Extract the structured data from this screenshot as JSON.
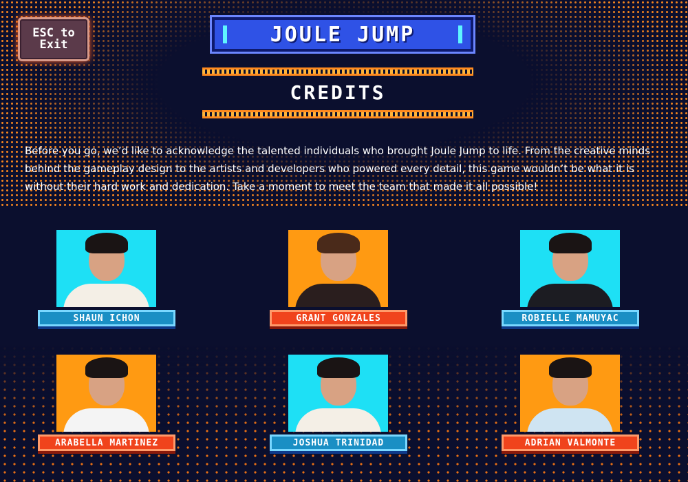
{
  "header": {
    "esc_label": "ESC to Exit",
    "game_title": "JOULE JUMP",
    "section_title": "CREDITS"
  },
  "intro_text": "Before you go, we’d like to acknowledge the talented individuals who brought Joule Jump to life. From the creative minds behind the gameplay design to the artists and developers who powered every detail, this game wouldn’t be what it is without their hard work and dedication. Take a moment to meet the team that made it all possible!",
  "colors": {
    "background": "#0b0f2e",
    "cyan_photo_bg": "#1ee0f5",
    "orange_photo_bg": "#ff9a12",
    "blue_bar": "#1a8fc4",
    "red_bar": "#f0431c",
    "title_blue": "#2f52e6"
  },
  "team": [
    {
      "name": "SHAUN ICHON",
      "photo_bg": "#1ee0f5",
      "bar": "blue",
      "hair": "#1a1414",
      "shirt": "#f4efe6"
    },
    {
      "name": "GRANT GONZALES",
      "photo_bg": "#ff9a12",
      "bar": "red",
      "hair": "#4a2a1a",
      "shirt": "#2a1e1e"
    },
    {
      "name": "ROBIELLE MAMUYAC",
      "photo_bg": "#1ee0f5",
      "bar": "blue",
      "hair": "#1a1414",
      "shirt": "#1c1c22"
    },
    {
      "name": "ARABELLA MARTINEZ",
      "photo_bg": "#ff9a12",
      "bar": "red",
      "hair": "#1a1414",
      "shirt": "#f4f4f4"
    },
    {
      "name": "JOSHUA TRINIDAD",
      "photo_bg": "#1ee0f5",
      "bar": "blue",
      "hair": "#1a1414",
      "shirt": "#f4efe6"
    },
    {
      "name": "ADRIAN VALMONTE",
      "photo_bg": "#ff9a12",
      "bar": "red",
      "hair": "#1a1414",
      "shirt": "#cfe4f2"
    }
  ]
}
